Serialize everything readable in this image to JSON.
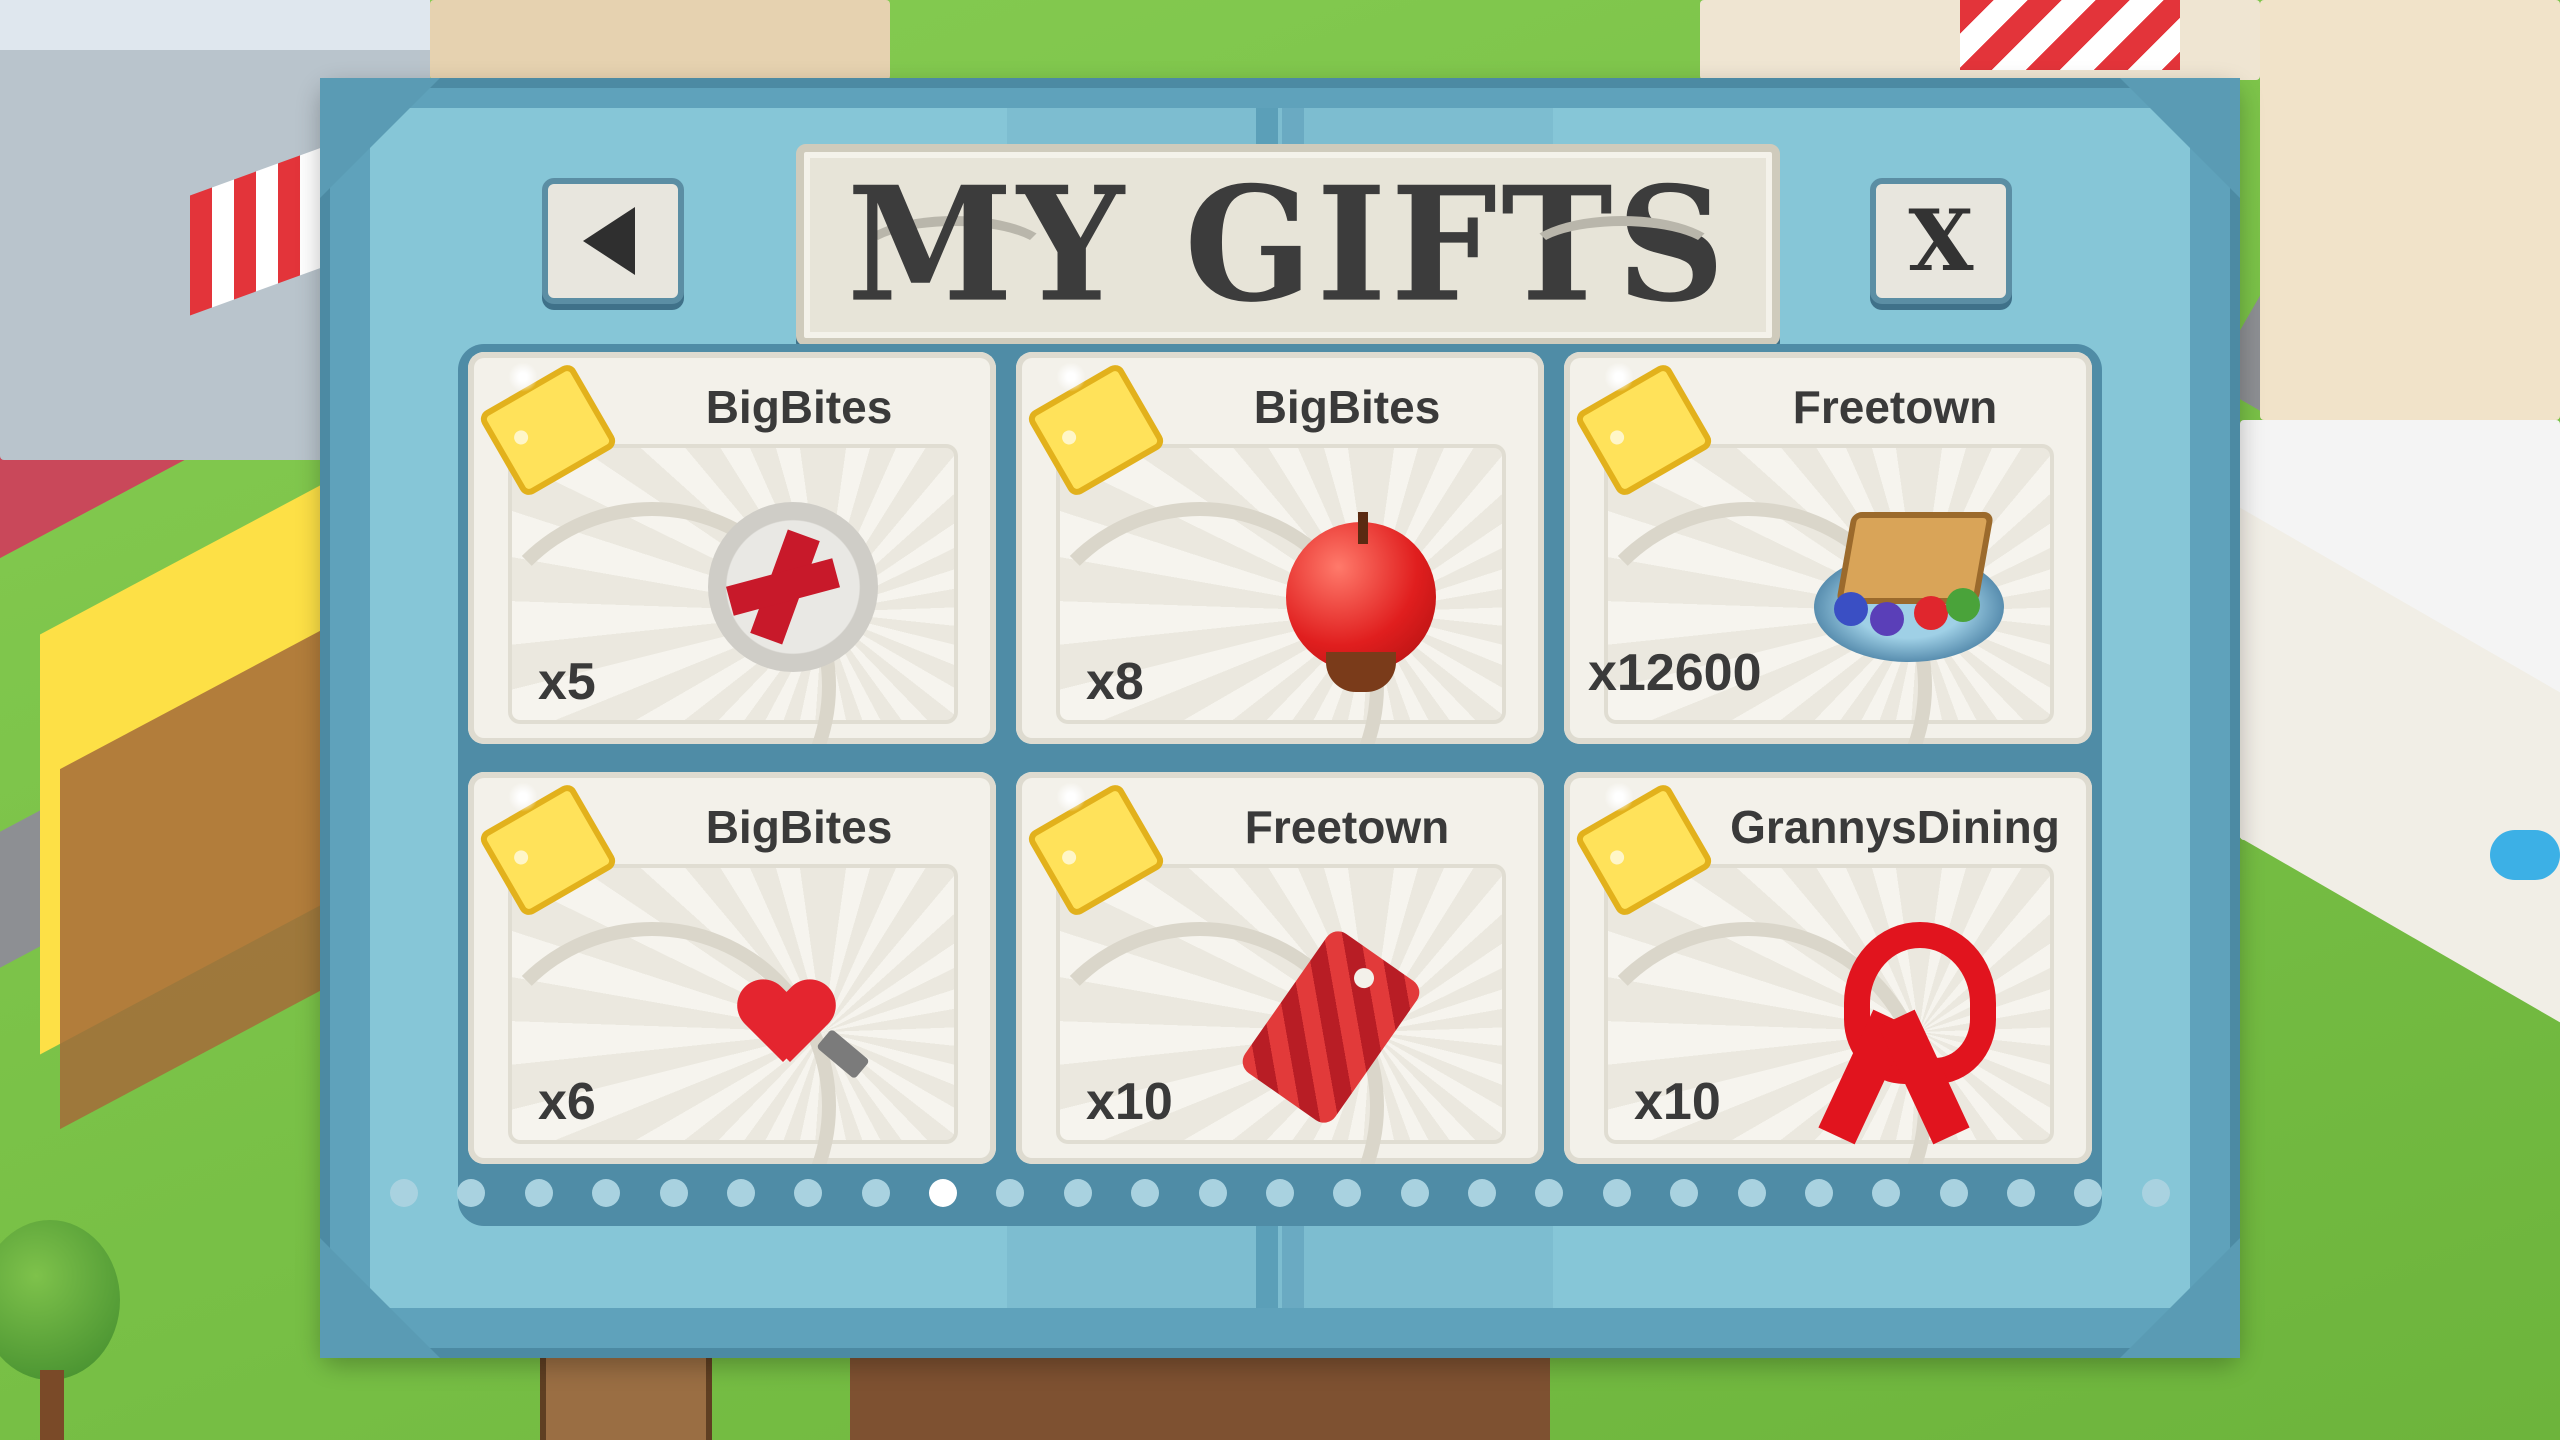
{
  "dialog": {
    "title": "MY GIFTS",
    "back_icon": "back-arrow-icon",
    "close_label": "X"
  },
  "gifts": [
    {
      "sender": "BigBites",
      "quantity": "x5",
      "item_icon": "repair-gear-icon"
    },
    {
      "sender": "BigBites",
      "quantity": "x8",
      "item_icon": "red-apple-icon"
    },
    {
      "sender": "Freetown",
      "quantity": "x12600",
      "item_icon": "cake-plate-icon"
    },
    {
      "sender": "BigBites",
      "quantity": "x6",
      "item_icon": "heart-screw-icon"
    },
    {
      "sender": "Freetown",
      "quantity": "x10",
      "item_icon": "red-price-tag-icon"
    },
    {
      "sender": "GrannysDining",
      "quantity": "x10",
      "item_icon": "red-ribbon-icon"
    }
  ],
  "pagination": {
    "total_pages": 27,
    "current_page": 9
  },
  "colors": {
    "frame": "#5fa2bb",
    "panel": "#86c6d7",
    "card": "#f3f1ea",
    "dot_active": "#ffffff",
    "dot_inactive": "#a9d2e0"
  }
}
